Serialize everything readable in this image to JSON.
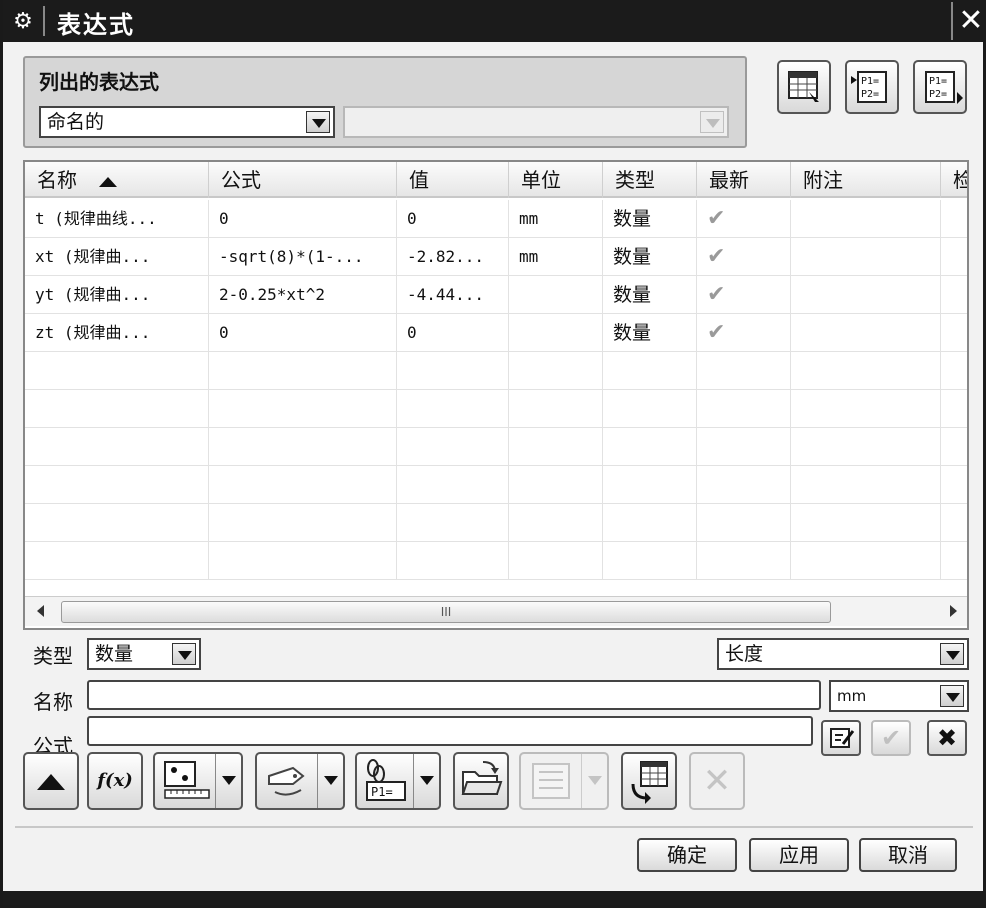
{
  "window": {
    "title": "表达式",
    "close_glyph": "✕"
  },
  "group": {
    "title": "列出的表达式",
    "list_filter": "命名的",
    "secondary_filter": ""
  },
  "top_tools": {
    "p1": "P1=",
    "p2": "P2="
  },
  "table": {
    "columns": [
      "名称",
      "公式",
      "值",
      "单位",
      "类型",
      "最新",
      "附注",
      "检"
    ],
    "rows": [
      {
        "name": "t  (规律曲线...",
        "formula": "0",
        "value": "0",
        "unit": "mm",
        "type": "数量",
        "latest": "✔"
      },
      {
        "name": "xt  (规律曲...",
        "formula": "-sqrt(8)*(1-...",
        "value": "-2.82...",
        "unit": "mm",
        "type": "数量",
        "latest": "✔"
      },
      {
        "name": "yt  (规律曲...",
        "formula": "2-0.25*xt^2",
        "value": "-4.44...",
        "unit": "",
        "type": "数量",
        "latest": "✔"
      },
      {
        "name": "zt  (规律曲...",
        "formula": "0",
        "value": "0",
        "unit": "",
        "type": "数量",
        "latest": "✔"
      }
    ],
    "scroll_thumb_grip": "III"
  },
  "form": {
    "type_label": "类型",
    "type_value": "数量",
    "dimension_value": "长度",
    "name_label": "名称",
    "name_value": "",
    "unit_value": "mm",
    "formula_label": "公式",
    "formula_value": ""
  },
  "toolbar": {
    "fx_label": "f(x)",
    "p1_label": "P1="
  },
  "buttons": {
    "ok": "确定",
    "apply": "应用",
    "cancel": "取消"
  }
}
